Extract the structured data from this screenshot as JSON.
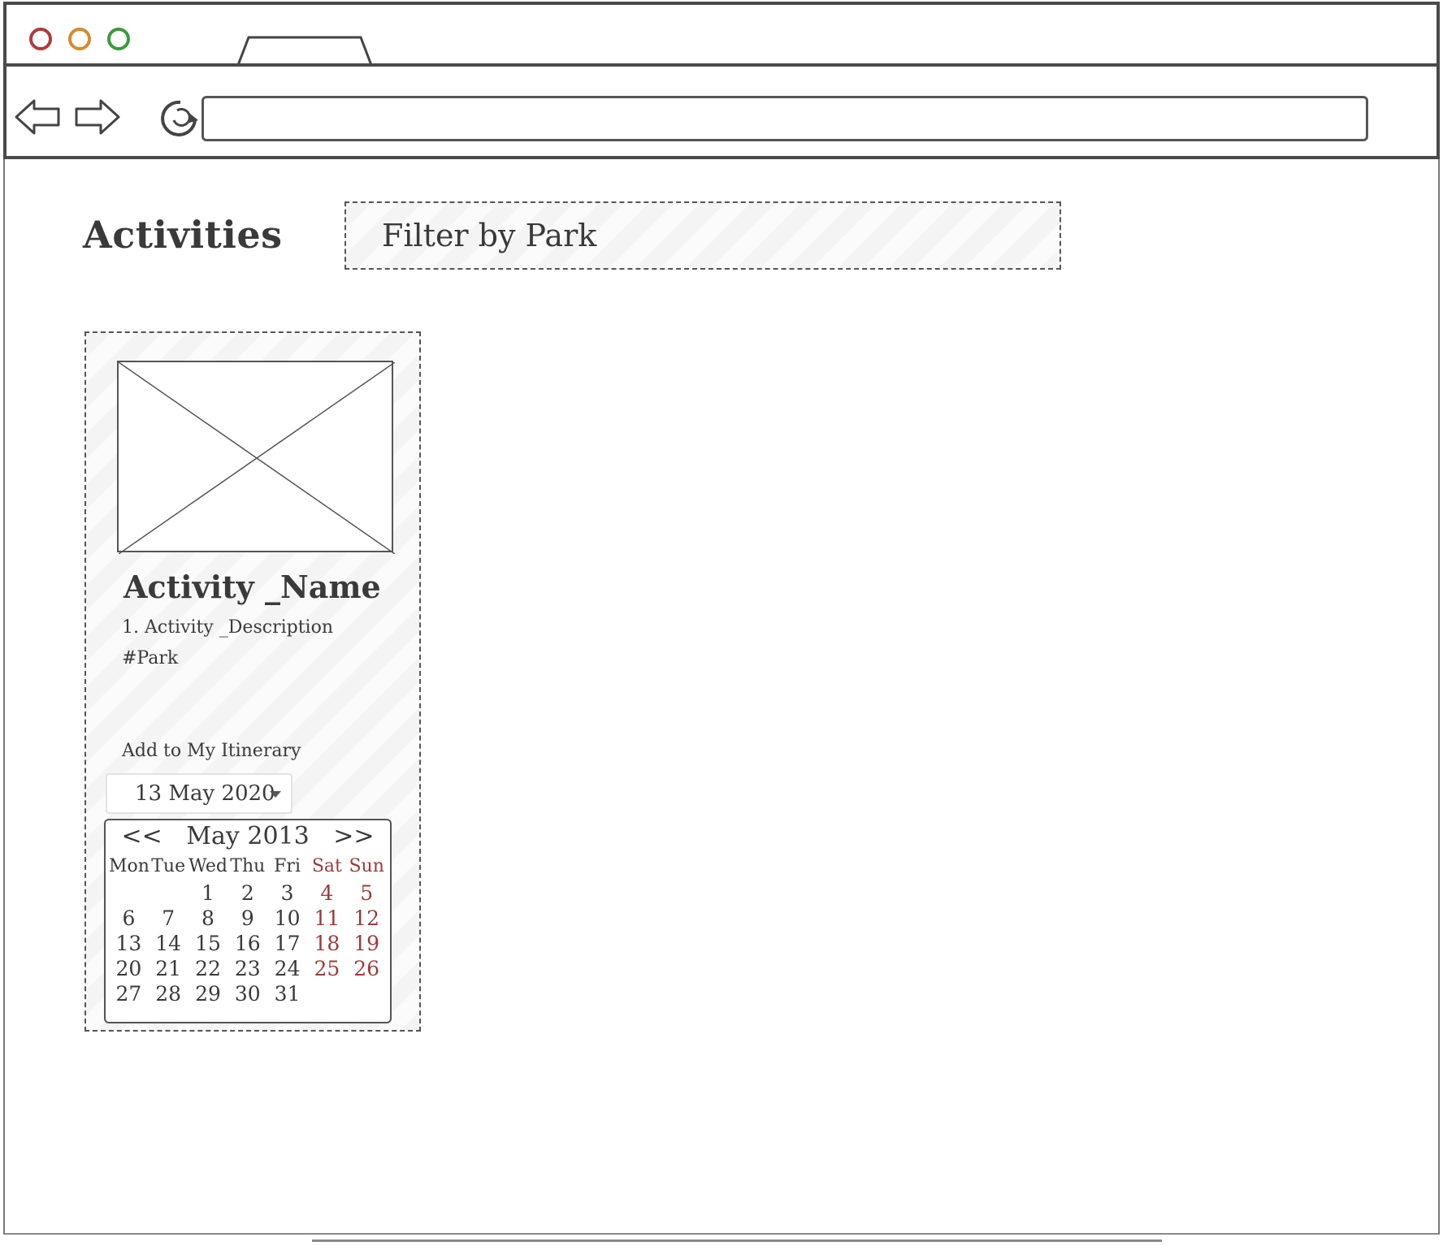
{
  "browser": {
    "url": ""
  },
  "page": {
    "title": "Activities",
    "filter_label": "Filter by Park"
  },
  "card": {
    "activity_name": "Activity _Name",
    "description": "1. Activity _Description",
    "park": "#Park",
    "add_label": "Add to My Itinerary",
    "date_value": "13 May 2020"
  },
  "calendar": {
    "prev": "<<",
    "month_label": "May 2013",
    "next": ">>",
    "day_names": [
      "Mon",
      "Tue",
      "Wed",
      "Thu",
      "Fri",
      "Sat",
      "Sun"
    ],
    "weeks": [
      [
        "",
        "",
        "1",
        "2",
        "3",
        "4",
        "5"
      ],
      [
        "6",
        "7",
        "8",
        "9",
        "10",
        "11",
        "12"
      ],
      [
        "13",
        "14",
        "15",
        "16",
        "17",
        "18",
        "19"
      ],
      [
        "20",
        "21",
        "22",
        "23",
        "24",
        "25",
        "26"
      ],
      [
        "27",
        "28",
        "29",
        "30",
        "31",
        "",
        ""
      ]
    ],
    "weekend_color": "#9b3a3a"
  },
  "icons": {
    "back": "arrow-left-icon",
    "forward": "arrow-right-icon",
    "reload": "reload-icon",
    "image_placeholder": "image-placeholder-icon"
  }
}
